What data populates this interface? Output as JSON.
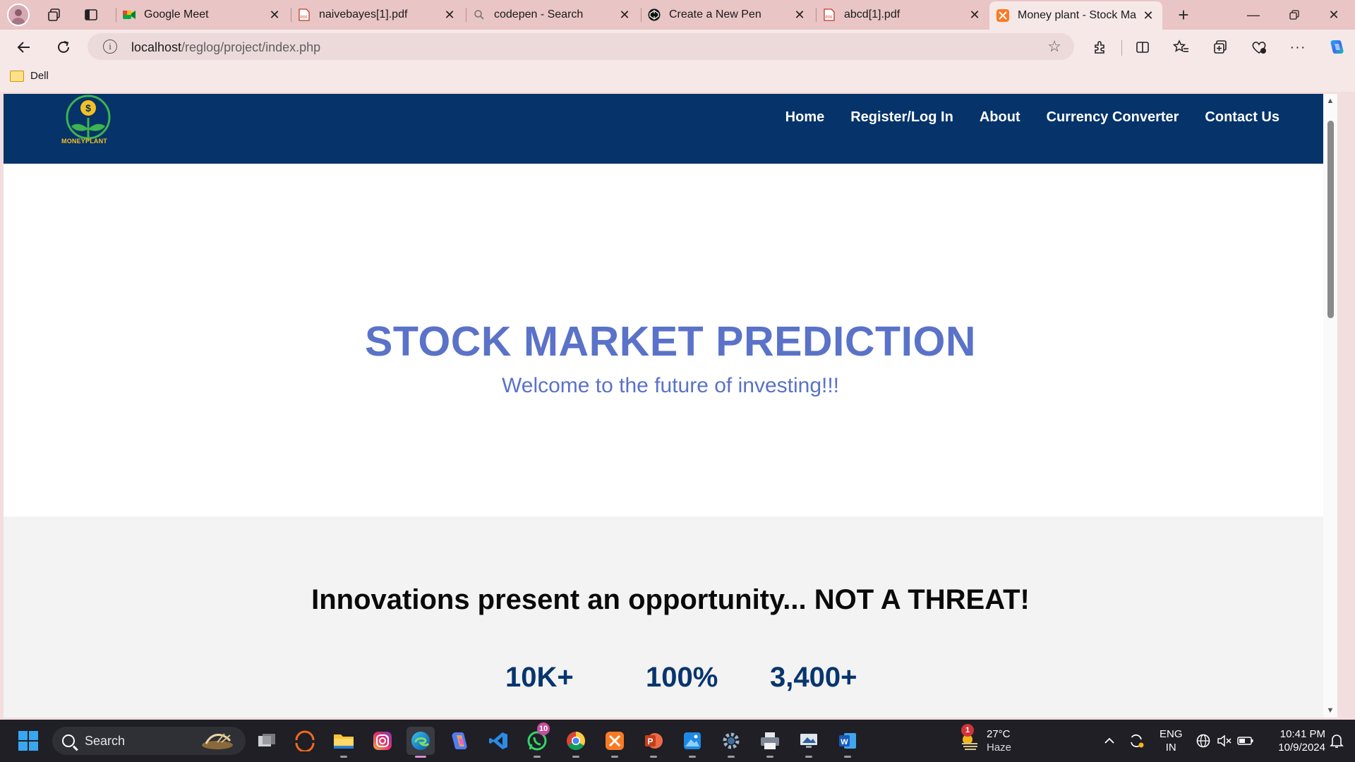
{
  "browser": {
    "tabs": [
      {
        "title": "Google Meet",
        "icon": "google-meet-icon"
      },
      {
        "title": "naivebayes[1].pdf",
        "icon": "pdf-icon"
      },
      {
        "title": "codepen - Search",
        "icon": "search-icon"
      },
      {
        "title": "Create a New Pen",
        "icon": "codepen-icon"
      },
      {
        "title": "abcd[1].pdf",
        "icon": "pdf-icon"
      },
      {
        "title": "Money plant - Stock Market",
        "icon": "xampp-icon",
        "active": true
      }
    ],
    "new_tab": "+",
    "address": {
      "host": "localhost",
      "path": "/reglog/project/index.php"
    },
    "bookmarks": [
      {
        "label": "Dell",
        "icon": "folder-icon"
      }
    ]
  },
  "site": {
    "logo_text": "MONEYPLANT",
    "nav": [
      "Home",
      "Register/Log In",
      "About",
      "Currency Converter",
      "Contact Us"
    ],
    "hero": {
      "title": "STOCK MARKET PREDICTION",
      "subtitle": "Welcome to the future of investing!!!"
    },
    "stats_heading": "Innovations present an opportunity... NOT A THREAT!",
    "stats": [
      "10K+",
      "100%",
      "3,400+"
    ]
  },
  "taskbar": {
    "search_placeholder": "Search",
    "apps": [
      "file-explorer-icon",
      "task-view-icon",
      "app-icon",
      "files-icon",
      "instagram-icon",
      "edge-icon",
      "copilot-icon",
      "vscode-icon",
      "whatsapp-icon",
      "chrome-icon",
      "xampp-icon",
      "powerpoint-icon",
      "photos-icon",
      "settings-icon",
      "printer-icon",
      "remote-desktop-icon",
      "word-icon"
    ],
    "whatsapp_badge": "10",
    "weather": {
      "temp": "27°C",
      "condition": "Haze",
      "badge": "1"
    },
    "language": {
      "line1": "ENG",
      "line2": "IN"
    },
    "clock": {
      "time": "10:41 PM",
      "date": "10/9/2024"
    }
  },
  "colors": {
    "nav_bg": "#05336a",
    "hero_text": "#5a72c8",
    "stat_text": "#07356e",
    "stats_bg": "#f3f3f4"
  }
}
